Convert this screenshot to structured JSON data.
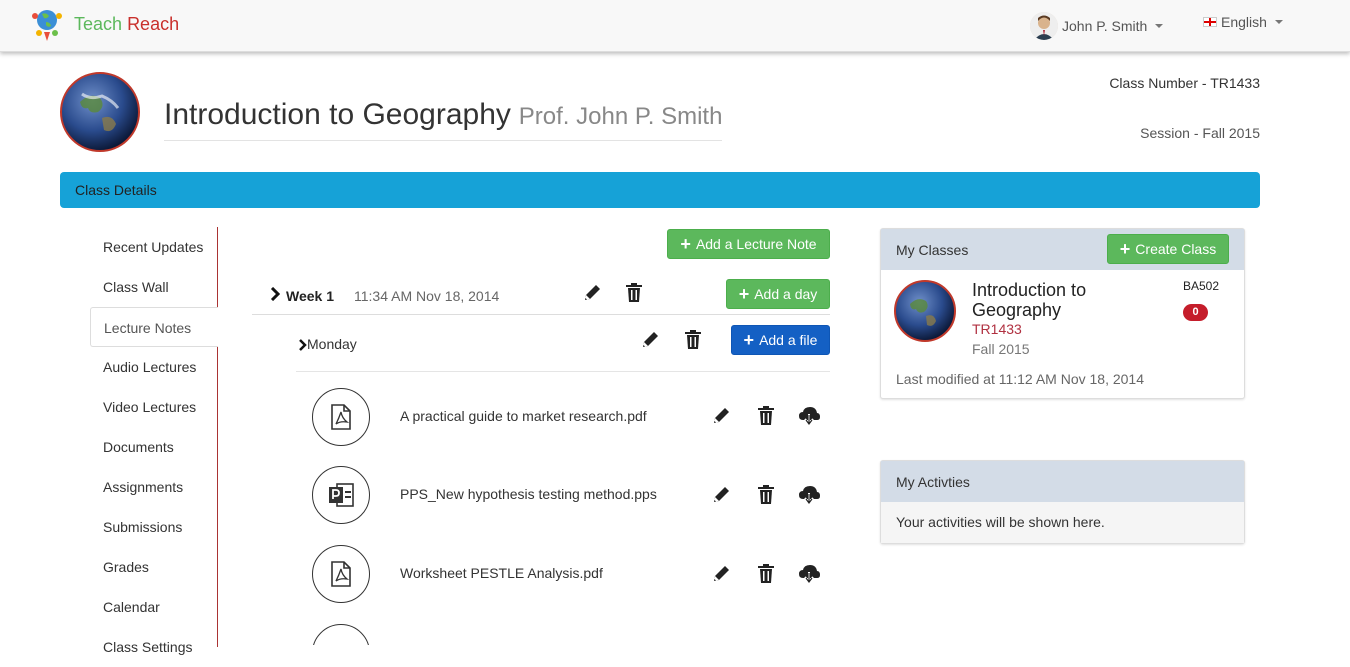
{
  "brand": {
    "word1": "Teach",
    "word2": "Reach"
  },
  "user": {
    "name": "John P. Smith"
  },
  "language": {
    "label": "English"
  },
  "class_info": {
    "title": "Introduction to Geography",
    "professor": "Prof. John P. Smith",
    "number": "Class Number - TR1433",
    "session": "Session - Fall 2015"
  },
  "details_bar": {
    "label": "Class Details"
  },
  "side_nav": {
    "items": [
      {
        "label": "Recent Updates"
      },
      {
        "label": "Class Wall"
      },
      {
        "label": "Lecture Notes"
      },
      {
        "label": "Audio Lectures"
      },
      {
        "label": "Video Lectures"
      },
      {
        "label": "Documents"
      },
      {
        "label": "Assignments"
      },
      {
        "label": "Submissions"
      },
      {
        "label": "Grades"
      },
      {
        "label": "Calendar"
      },
      {
        "label": "Class Settings"
      }
    ],
    "active_index": 2
  },
  "lecture_notes": {
    "add_note_label": "Add a Lecture Note",
    "week": {
      "label": "Week 1",
      "time": "11:34 AM Nov 18, 2014",
      "add_day_label": "Add a day"
    },
    "day": {
      "label": "Monday",
      "add_file_label": "Add a file"
    },
    "files": [
      {
        "name": "A practical guide to market research.pdf",
        "type": "pdf"
      },
      {
        "name": "PPS_New hypothesis testing method.pps",
        "type": "pps"
      },
      {
        "name": "Worksheet PESTLE Analysis.pdf",
        "type": "pdf"
      }
    ]
  },
  "my_classes": {
    "heading": "My Classes",
    "create_label": "Create Class",
    "card": {
      "title": "Introduction to Geography",
      "code": "TR1433",
      "term": "Fall 2015",
      "course_code": "BA502",
      "badge": "0",
      "modified": "Last modified at 11:12 AM Nov 18, 2014"
    }
  },
  "my_activities": {
    "heading": "My Activties",
    "message": "Your activities will be shown here."
  },
  "colors": {
    "accent_blue": "#16a2d7",
    "success_green": "#5cb85c",
    "primary_blue": "#1460c4",
    "danger_red": "#c51d2b"
  }
}
